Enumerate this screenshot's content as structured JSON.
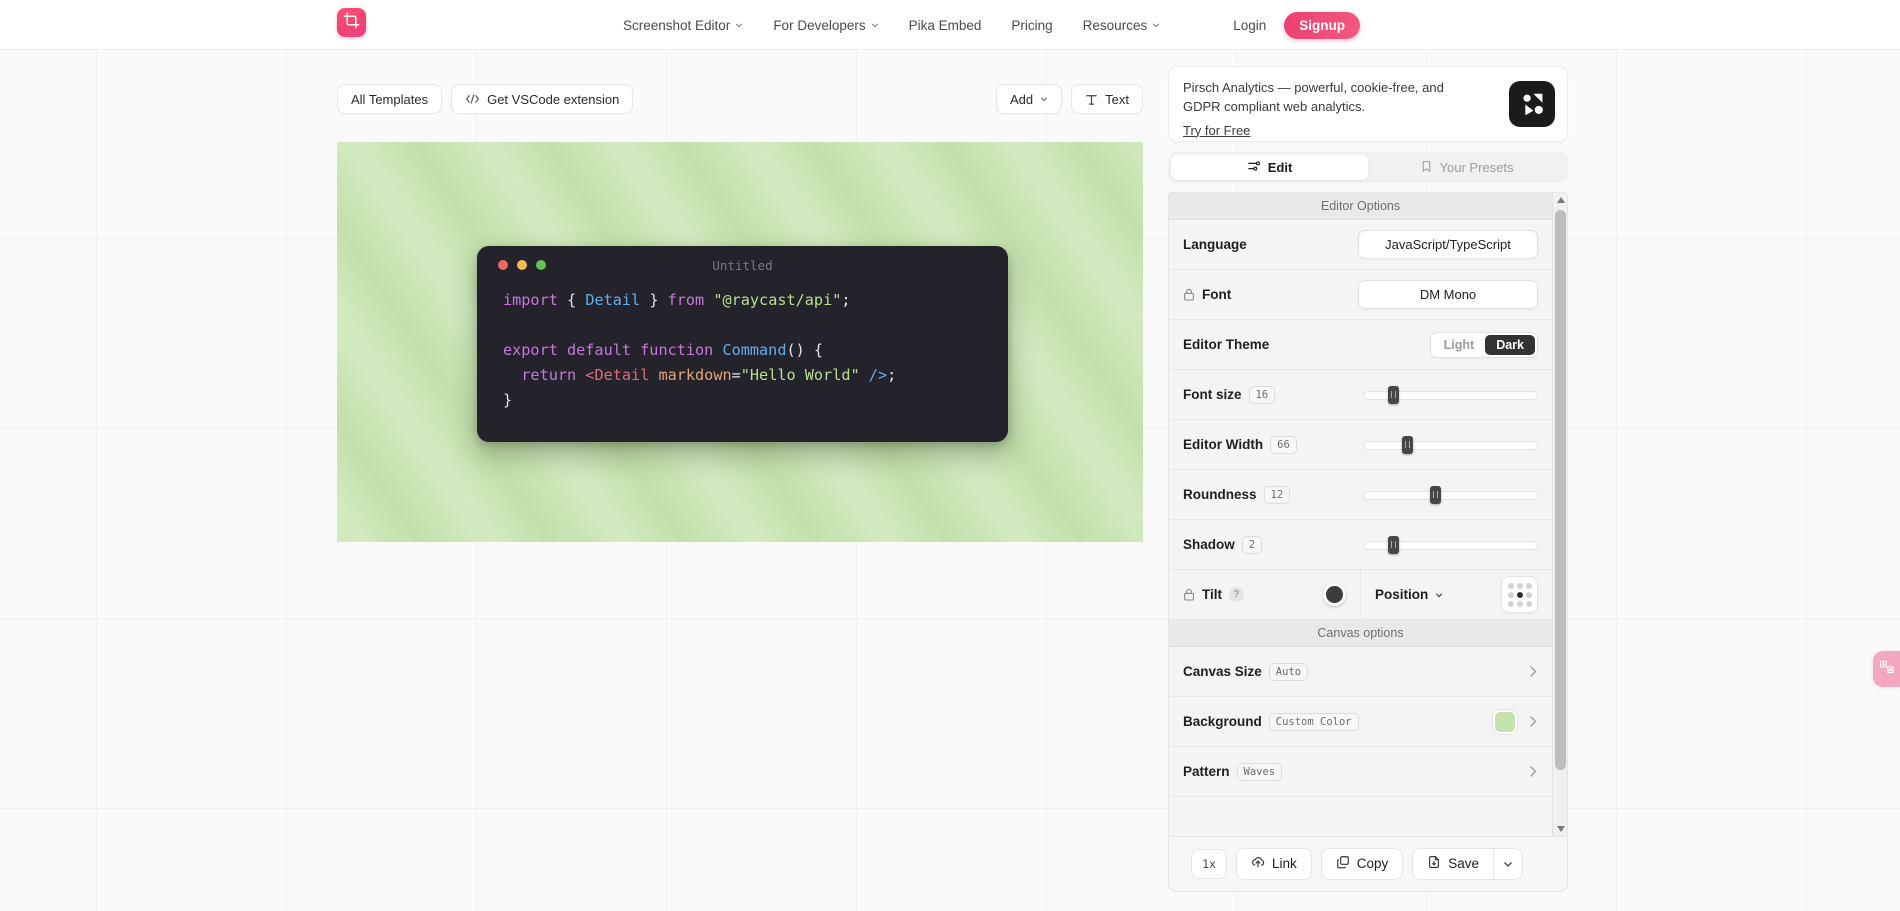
{
  "header": {
    "logo_icon": "crop-tool-icon",
    "nav": [
      {
        "label": "Screenshot Editor",
        "has_caret": true
      },
      {
        "label": "For Developers",
        "has_caret": true
      },
      {
        "label": "Pika Embed",
        "has_caret": false
      },
      {
        "label": "Pricing",
        "has_caret": false
      },
      {
        "label": "Resources",
        "has_caret": true
      }
    ],
    "login_label": "Login",
    "signup_label": "Signup",
    "signup_color": "#ed4072"
  },
  "toolbar": {
    "all_templates_label": "All Templates",
    "vscode_label": "Get VSCode extension",
    "vscode_icon": "code-brackets-icon",
    "add_label": "Add",
    "text_label": "Text",
    "text_icon": "text-tool-icon"
  },
  "canvas": {
    "window_title": "Untitled",
    "traffic_lights": [
      "#ed6a5e",
      "#f4bd4f",
      "#61c554"
    ],
    "background_color": "#c9e5b3",
    "code_lines": [
      [
        {
          "t": "import ",
          "c": "k"
        },
        {
          "t": "{ ",
          "c": "p"
        },
        {
          "t": "Detail",
          "c": "t"
        },
        {
          "t": " } ",
          "c": "p"
        },
        {
          "t": "from ",
          "c": "k"
        },
        {
          "t": "\"@raycast/api\"",
          "c": "s"
        },
        {
          "t": ";",
          "c": "p"
        }
      ],
      [],
      [
        {
          "t": "export default function ",
          "c": "k"
        },
        {
          "t": "Command",
          "c": "t"
        },
        {
          "t": "() {",
          "c": "p"
        }
      ],
      [
        {
          "t": "  return ",
          "c": "k"
        },
        {
          "t": "<Detail",
          "c": "tg"
        },
        {
          "t": " markdown",
          "c": "at"
        },
        {
          "t": "=",
          "c": "p"
        },
        {
          "t": "\"Hello World\"",
          "c": "s"
        },
        {
          "t": " ",
          "c": "p"
        },
        {
          "t": "/>",
          "c": "t"
        },
        {
          "t": ";",
          "c": "p"
        }
      ],
      [
        {
          "t": "}",
          "c": "p"
        }
      ]
    ]
  },
  "ad": {
    "text": "Pirsch Analytics — powerful, cookie-free, and GDPR compliant web analytics.",
    "cta": "Try for Free",
    "logo_icon": "pirsch-logo-icon"
  },
  "tabs": [
    {
      "label": "Edit",
      "icon": "sliders-icon",
      "active": true
    },
    {
      "label": "Your Presets",
      "icon": "bookmark-icon",
      "active": false
    }
  ],
  "editor_options": {
    "section_title": "Editor Options",
    "language": {
      "label": "Language",
      "value": "JavaScript/TypeScript"
    },
    "font": {
      "label": "Font",
      "value": "DM Mono",
      "locked": true,
      "lock_icon": "lock-icon"
    },
    "theme": {
      "label": "Editor Theme",
      "options": [
        "Light",
        "Dark"
      ],
      "selected": "Dark"
    },
    "sliders": [
      {
        "label": "Font size",
        "value": "16",
        "percent": 17
      },
      {
        "label": "Editor Width",
        "value": "66",
        "percent": 25
      },
      {
        "label": "Roundness",
        "value": "12",
        "percent": 41
      },
      {
        "label": "Shadow",
        "value": "2",
        "percent": 17
      }
    ],
    "tilt": {
      "label": "Tilt",
      "locked": true,
      "lock_icon": "lock-icon",
      "help_icon": "question-icon",
      "swatch_color": "#3b3b3b"
    },
    "position": {
      "label": "Position",
      "selected_cell": 4,
      "caret_icon": "chevron-down-icon"
    }
  },
  "canvas_options": {
    "section_title": "Canvas options",
    "rows": [
      {
        "label": "Canvas Size",
        "pill": "Auto",
        "chip": false,
        "chevron_icon": "chevron-right-icon"
      },
      {
        "label": "Background",
        "pill": "Custom Color",
        "chip": true,
        "chip_color": "#c5e3ad",
        "chevron_icon": "chevron-right-icon"
      },
      {
        "label": "Pattern",
        "pill": "Waves",
        "chip": false,
        "chevron_icon": "chevron-right-icon"
      }
    ]
  },
  "bottom_bar": {
    "zoom_label": "1x",
    "link_label": "Link",
    "link_icon": "cloud-upload-icon",
    "copy_label": "Copy",
    "copy_icon": "copy-icon",
    "save_label": "Save",
    "save_icon": "file-download-icon",
    "caret_icon": "chevron-down-icon"
  },
  "floating": {
    "translate_icon": "translate-icon",
    "color": "#f4a7c0"
  }
}
